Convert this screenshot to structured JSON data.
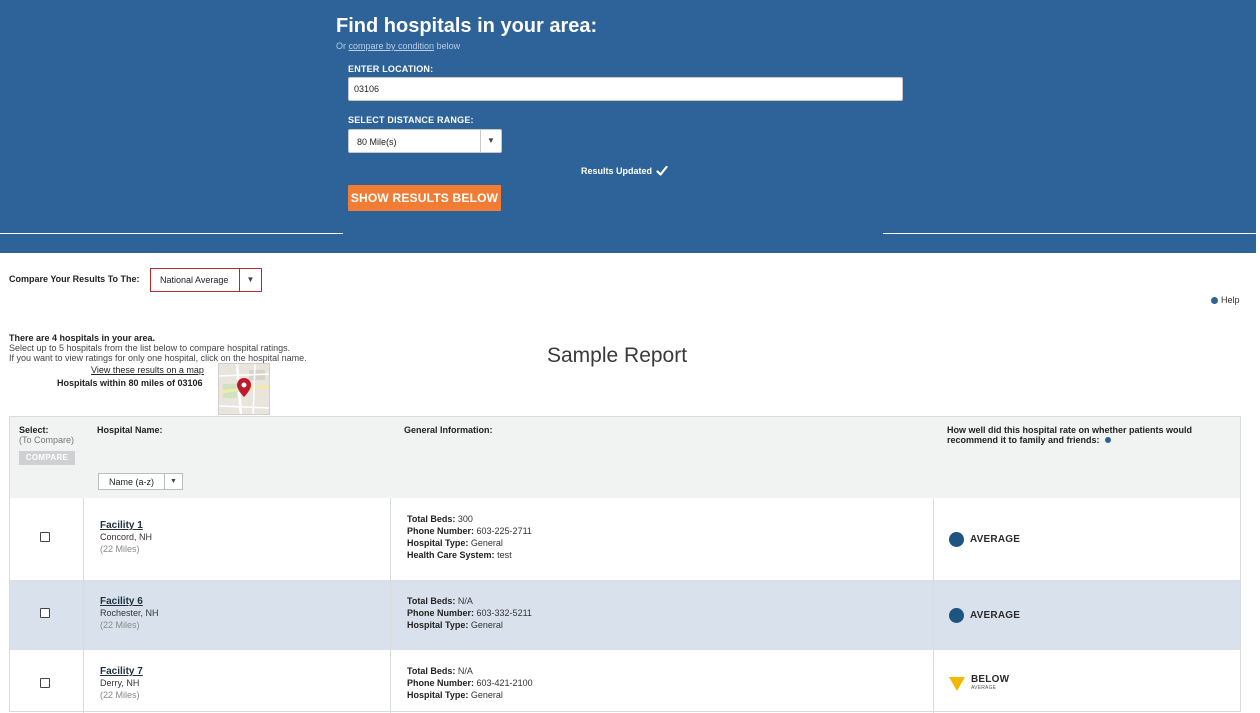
{
  "header": {
    "title": "Find hospitals in your area:",
    "subtitle_prefix": "Or",
    "subtitle_link": "compare by condition",
    "subtitle_suffix": "below",
    "location_label": "ENTER LOCATION:",
    "location_value": "03106",
    "distance_label": "SELECT DISTANCE RANGE:",
    "distance_value": "80 Mile(s)",
    "results_updated": "Results Updated",
    "show_results_button": "SHOW RESULTS BELOW"
  },
  "compare": {
    "label": "Compare Your Results To The:",
    "value": "National Average",
    "help_label": "Help"
  },
  "intro": {
    "count_text": "There are 4 hospitals in your area.",
    "instruction_1": "Select up to 5 hospitals from the list below to compare hospital ratings.",
    "instruction_2": "If you want to view ratings for only one hospital, click on the hospital name.",
    "map_link": "View these results on a map",
    "within_text": "Hospitals within 80 miles of 03106",
    "sample_report": "Sample Report"
  },
  "table": {
    "col_select": "Select:",
    "col_select_sub": "(To Compare)",
    "compare_button": "COMPARE",
    "col_name": "Hospital Name:",
    "sort_value": "Name (a-z)",
    "col_info": "General Information:",
    "col_rating": "How well did this hospital rate on whether patients would recommend it to family and friends:",
    "rows": [
      {
        "name": "Facility 1",
        "city": "Concord, NH",
        "distance": "(22 Miles)",
        "beds_label": "Total Beds:",
        "beds": "300",
        "phone_label": "Phone Number:",
        "phone": "603-225-2711",
        "type_label": "Hospital Type:",
        "type": "General",
        "system_label": "Health Care System:",
        "system": "test",
        "rating": "AVERAGE"
      },
      {
        "name": "Facility 6",
        "city": "Rochester, NH",
        "distance": "(22 Miles)",
        "beds_label": "Total Beds:",
        "beds": "N/A",
        "phone_label": "Phone Number:",
        "phone": "603-332-5211",
        "type_label": "Hospital Type:",
        "type": "General",
        "rating": "AVERAGE"
      },
      {
        "name": "Facility 7",
        "city": "Derry, NH",
        "distance": "(22 Miles)",
        "beds_label": "Total Beds:",
        "beds": "N/A",
        "phone_label": "Phone Number:",
        "phone": "603-421-2100",
        "type_label": "Hospital Type:",
        "type": "General",
        "rating": "BELOW",
        "rating_sub": "AVERAGE"
      }
    ]
  },
  "colors": {
    "header_blue": "#2d6398",
    "button_orange": "#f07d33",
    "alt_row": "#d9e2ec",
    "average_dot": "#1d5480",
    "below_triangle": "#f2b800"
  },
  "icons": [
    "check-icon",
    "chevron-down-icon",
    "info-icon",
    "map-pin-icon",
    "average-dot-icon",
    "below-triangle-icon"
  ]
}
